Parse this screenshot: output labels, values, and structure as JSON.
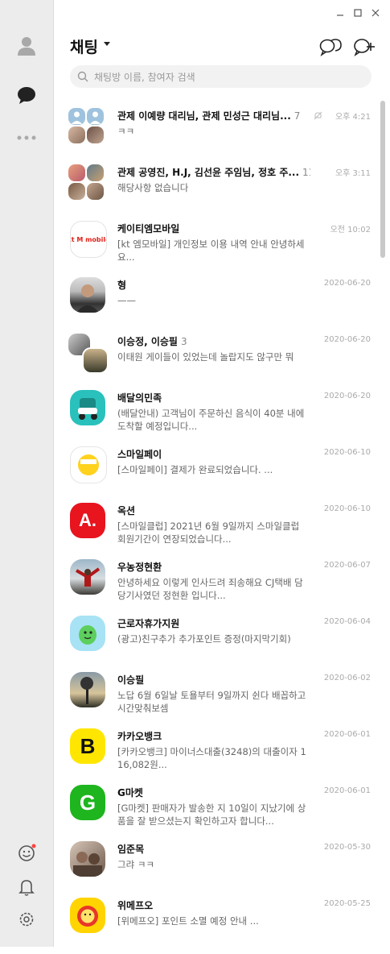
{
  "sidebar": {
    "friends_icon": "person-icon",
    "chats_icon": "chat-bubble-icon",
    "more_icon": "more-dots-icon",
    "emoticon_icon": "emoticon-icon",
    "notifications_icon": "bell-icon",
    "settings_icon": "gear-icon"
  },
  "header": {
    "title": "채팅",
    "search_placeholder": "채팅방 이름, 참여자 검색"
  },
  "chats": [
    {
      "name": "관제 이예량 대리님, 관제 민성근 대리님...",
      "count": "7",
      "time": "오후 4:21",
      "message": "ㅋㅋ"
    },
    {
      "name": "관제 공영진, H.J, 김선윤 주임님, 정호 주...",
      "count": "11",
      "time": "오후 3:11",
      "message": "해당사항 없습니다"
    },
    {
      "name": "케이티엠모바일",
      "count": "",
      "time": "오전 10:02",
      "message": "[kt 엠모바일] 개인정보 이용 내역 안내 안녕하세요..."
    },
    {
      "name": "형",
      "count": "",
      "time": "2020-06-20",
      "message": "——"
    },
    {
      "name": "이승정, 이승필",
      "count": "3",
      "time": "2020-06-20",
      "message": "이태원 게이들이 있었는데 놀랍지도 않구만 뭐"
    },
    {
      "name": "배달의민족",
      "count": "",
      "time": "2020-06-20",
      "message": "(배달안내) 고객님이 주문하신 음식이 40분 내에 도착할 예정입니다..."
    },
    {
      "name": "스마일페이",
      "count": "",
      "time": "2020-06-10",
      "message": "[스마일페이] 결제가 완료되었습니다. ..."
    },
    {
      "name": "옥션",
      "count": "",
      "time": "2020-06-10",
      "message": "[스마일클럽] 2021년 6월 9일까지 스마일클럽 회원기간이 연장되었습니다..."
    },
    {
      "name": "우농정현환",
      "count": "",
      "time": "2020-06-07",
      "message": "안녕하세요 이렇게 인사드려 죄송해요 CJ택배 담당기사였던 정현환 입니다..."
    },
    {
      "name": "근로자휴가지원",
      "count": "",
      "time": "2020-06-04",
      "message": "(광고)친구추가 추가포인트 증정(마지막기회)"
    },
    {
      "name": "이승필",
      "count": "",
      "time": "2020-06-02",
      "message": "노답 6월 6일날 토욜부터 9일까지 쉰다 배꼽하고 시간맞춰보셈"
    },
    {
      "name": "카카오뱅크",
      "count": "",
      "time": "2020-06-01",
      "message": "[카카오뱅크] 마이너스대출(3248)의 대출이자 116,082원..."
    },
    {
      "name": "G마켓",
      "count": "",
      "time": "2020-06-01",
      "message": "[G마켓] 판매자가 발송한 지 10일이 지났기에 상품을 잘 받으셨는지 확인하고자 합니다..."
    },
    {
      "name": "임준목",
      "count": "",
      "time": "2020-05-30",
      "message": "그랴 ㅋㅋ"
    },
    {
      "name": "위메프오",
      "count": "",
      "time": "2020-05-25",
      "message": "[위메프오] 포인트 소멸 예정 안내 ..."
    }
  ],
  "logos": {
    "kt": "kt M mobile",
    "auction": "A.",
    "kakaobank": "B",
    "gmarket": "G"
  },
  "colors": {
    "sidebar_bg": "#ececec",
    "notification_dot": "#f44"
  }
}
